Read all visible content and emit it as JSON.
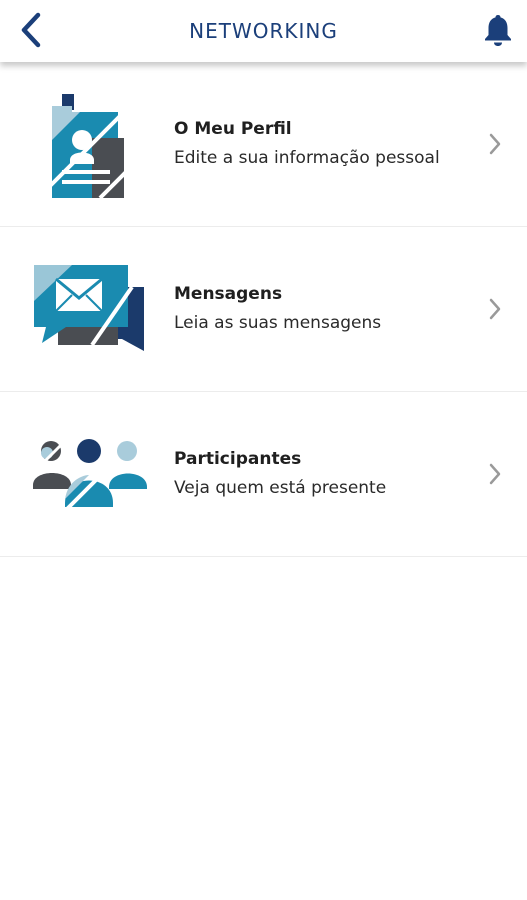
{
  "header": {
    "title": "NETWORKING",
    "back_icon": "chevron-left-icon",
    "notification_icon": "bell-icon",
    "accent_color": "#1b3f7a"
  },
  "menu": {
    "items": [
      {
        "title": "O Meu Perfil",
        "subtitle": "Edite a sua informação pessoal",
        "icon": "profile-badge-icon"
      },
      {
        "title": "Mensagens",
        "subtitle": "Leia as suas mensagens",
        "icon": "messages-icon"
      },
      {
        "title": "Participantes",
        "subtitle": "Veja quem está presente",
        "icon": "participants-icon"
      }
    ]
  },
  "colors": {
    "blue": "#1a8bb0",
    "light_blue": "#a9ccdb",
    "navy": "#1b3a6b",
    "gray": "#4a4d52"
  }
}
